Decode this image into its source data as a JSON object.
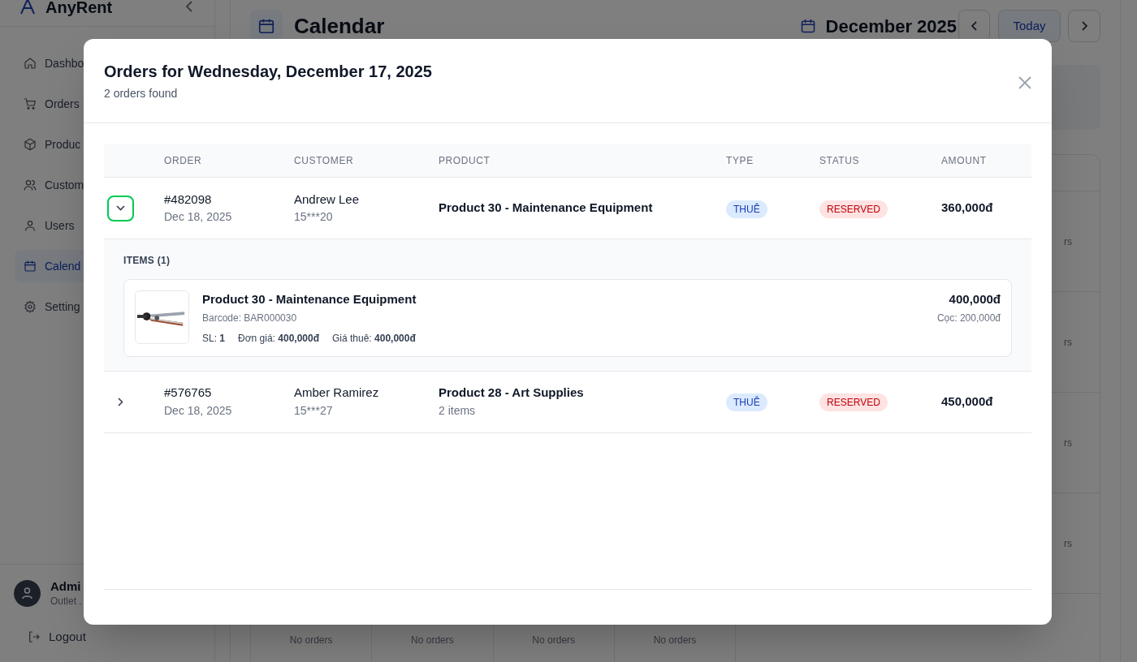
{
  "app": {
    "name": "AnyRent",
    "sidebar_items": [
      {
        "label": "Dashbo",
        "selected": false
      },
      {
        "label": "Orders",
        "selected": false
      },
      {
        "label": "Produc",
        "selected": false
      },
      {
        "label": "Custom",
        "selected": false
      },
      {
        "label": "Users",
        "selected": false
      },
      {
        "label": "Calend",
        "selected": true
      },
      {
        "label": "Setting",
        "selected": false
      }
    ],
    "user": {
      "name": "Admi",
      "subtitle": "Outlet ."
    },
    "logout": "Logout"
  },
  "header": {
    "title": "Calendar",
    "month": "December 2025",
    "today": "Today"
  },
  "calendar": {
    "right_cells": [
      "rs",
      "rs",
      "rs",
      "rs"
    ],
    "bottom_cells": [
      "No orders",
      "No orders",
      "No orders",
      "No orders"
    ]
  },
  "modal": {
    "title": "Orders for Wednesday, December 17, 2025",
    "subtitle": "2 orders found",
    "columns": [
      "ORDER",
      "CUSTOMER",
      "PRODUCT",
      "TYPE",
      "STATUS",
      "AMOUNT"
    ],
    "orders": [
      {
        "expanded": true,
        "order": "#482098",
        "date": "Dec 18, 2025",
        "customer": "Andrew Lee",
        "phone": "15***20",
        "product": "Product 30 - Maintenance Equipment",
        "type": "THUÊ",
        "status": "RESERVED",
        "amount": "360,000đ",
        "items_heading": "ITEMS (1)",
        "items": [
          {
            "name": "Product 30 - Maintenance Equipment",
            "barcode": "Barcode: BAR000030",
            "qty": "SL: **1**",
            "unit_price": "Đơn giá: **400,000đ**",
            "rent_price": "Giá thuê: **400,000đ**",
            "total": "400,000đ",
            "deposit": "Cọc: 200,000đ"
          }
        ]
      },
      {
        "expanded": false,
        "order": "#576765",
        "date": "Dec 18, 2025",
        "customer": "Amber Ramirez",
        "phone": "15***27",
        "product": "Product 28 - Art Supplies",
        "product_note": "2 items",
        "type": "THUÊ",
        "status": "RESERVED",
        "amount": "450,000đ"
      }
    ]
  }
}
